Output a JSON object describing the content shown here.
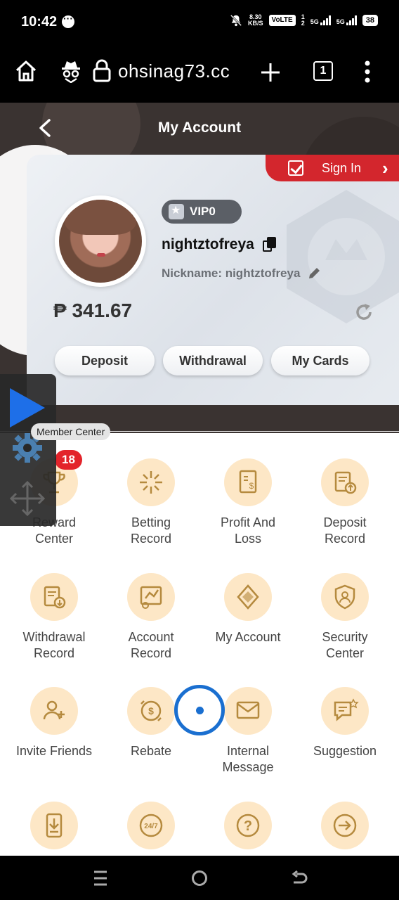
{
  "status_bar": {
    "time": "10:42",
    "net_speed_top": "8.30",
    "net_speed_bottom": "KB/S",
    "volte": "VoLTE",
    "sim_top": "1",
    "sim_bottom": "2",
    "sig1": "5G",
    "sig2": "5G",
    "battery": "38"
  },
  "browser": {
    "url": "ohsinag73.cc",
    "tab_count": "1"
  },
  "header": {
    "title": "My Account"
  },
  "account": {
    "sign_in_label": "Sign In",
    "vip_label": "VIP0",
    "username": "nightztofreya",
    "nickname": "Nickname: nightztofreya",
    "balance": "₱ 341.67",
    "buttons": {
      "deposit": "Deposit",
      "withdrawal": "Withdrawal",
      "my_cards": "My Cards"
    }
  },
  "member_center": {
    "label": "Member Center",
    "reward_badge": "18",
    "tiles": [
      {
        "label": "Reward\nCenter",
        "icon": "trophy-icon"
      },
      {
        "label": "Betting\nRecord",
        "icon": "betting-icon"
      },
      {
        "label": "Profit And\nLoss",
        "icon": "profit-icon"
      },
      {
        "label": "Deposit\nRecord",
        "icon": "deposit-record-icon"
      },
      {
        "label": "Withdrawal\nRecord",
        "icon": "withdrawal-record-icon"
      },
      {
        "label": "Account\nRecord",
        "icon": "account-record-icon"
      },
      {
        "label": "My Account",
        "icon": "my-account-icon"
      },
      {
        "label": "Security\nCenter",
        "icon": "shield-icon"
      },
      {
        "label": "Invite Friends",
        "icon": "invite-icon"
      },
      {
        "label": "Rebate",
        "icon": "rebate-icon"
      },
      {
        "label": "Internal\nMessage",
        "icon": "message-icon"
      },
      {
        "label": "Suggestion",
        "icon": "suggestion-icon"
      }
    ],
    "bottom_row_icons": [
      "download-icon",
      "support-24-7-icon",
      "help-icon",
      "logout-icon"
    ]
  },
  "colors": {
    "accent_red": "#d3262d",
    "tile_bg": "#fde7c6",
    "icon_gold": "#b58a3e",
    "header_dark": "#3a3331",
    "fab_blue": "#1a6fd0"
  }
}
